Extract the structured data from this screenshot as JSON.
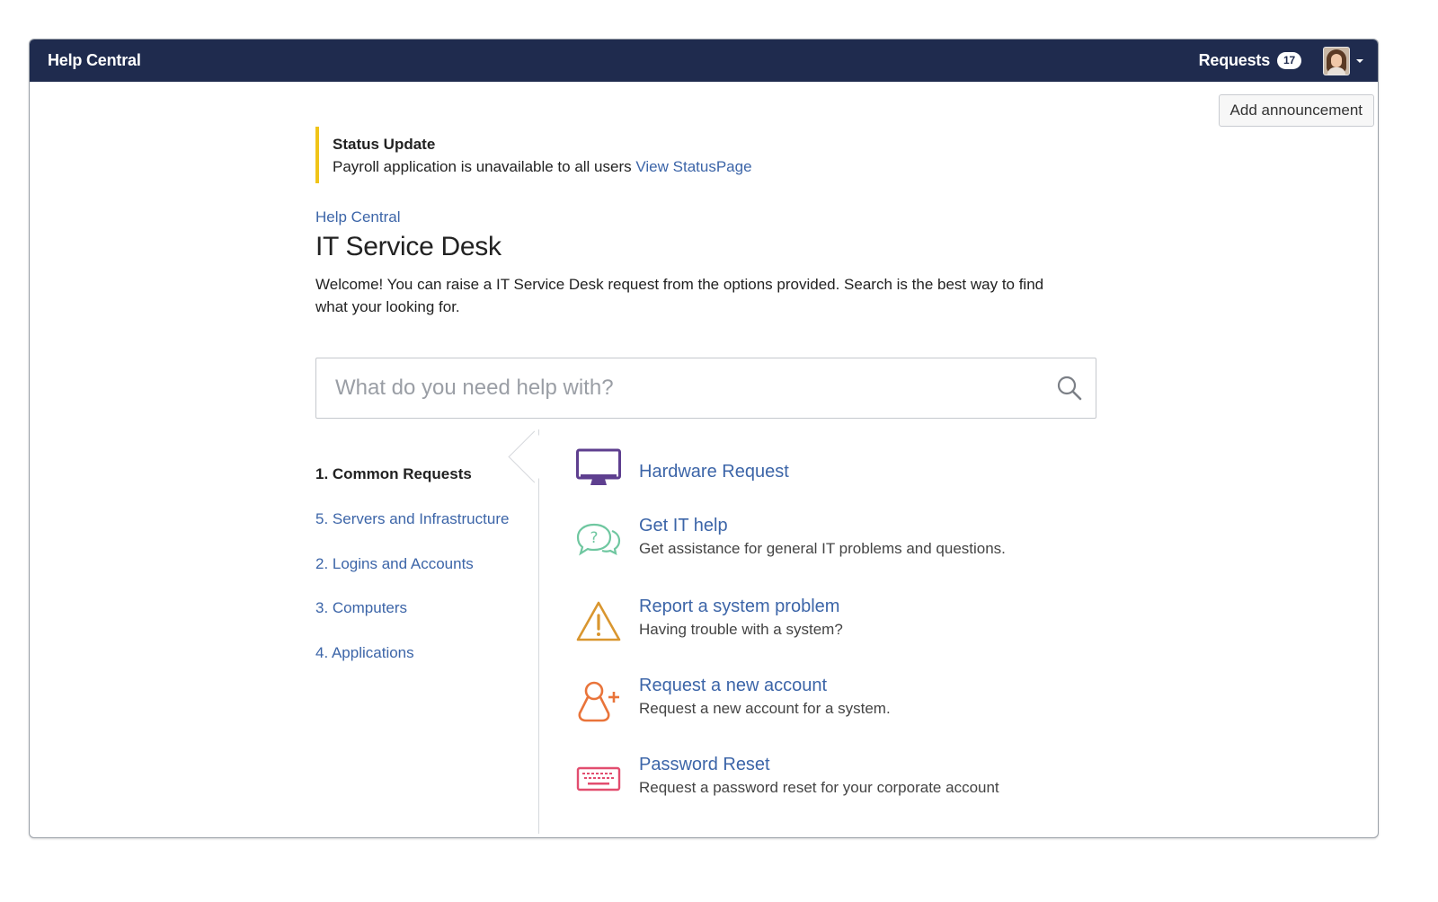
{
  "header": {
    "brand": "Help Central",
    "requests_label": "Requests",
    "requests_count": "17"
  },
  "add_announcement_label": "Add announcement",
  "announcement": {
    "title": "Status Update",
    "message": "Payroll application is unavailable to all users",
    "link_text": "View StatusPage",
    "accent_color": "#f0c419"
  },
  "breadcrumb": "Help Central",
  "page_title": "IT Service Desk",
  "welcome_text": "Welcome! You can raise a IT Service Desk request from the options provided. Search is the best way to find what your looking for.",
  "search": {
    "placeholder": "What do you need help with?"
  },
  "groups": [
    {
      "label": "1. Common Requests",
      "active": true
    },
    {
      "label": "5. Servers and Infrastructure",
      "active": false
    },
    {
      "label": "2. Logins and Accounts",
      "active": false
    },
    {
      "label": "3. Computers",
      "active": false
    },
    {
      "label": "4. Applications",
      "active": false
    }
  ],
  "request_types": [
    {
      "name": "Hardware Request",
      "description": "",
      "icon": "monitor-icon",
      "color": "#5e3f8f"
    },
    {
      "name": "Get IT help",
      "description": "Get assistance for general IT problems and questions.",
      "icon": "question-chat-icon",
      "color": "#6fc7a0"
    },
    {
      "name": "Report a system problem",
      "description": "Having trouble with a system?",
      "icon": "warning-icon",
      "color": "#d9962f"
    },
    {
      "name": "Request a new account",
      "description": "Request a new account for a system.",
      "icon": "add-user-icon",
      "color": "#e9743a"
    },
    {
      "name": "Password Reset",
      "description": "Request a password reset for your corporate account",
      "icon": "keyboard-icon",
      "color": "#e24d6f"
    }
  ],
  "colors": {
    "topbar": "#1f2b4e",
    "link": "#3c65a8"
  }
}
